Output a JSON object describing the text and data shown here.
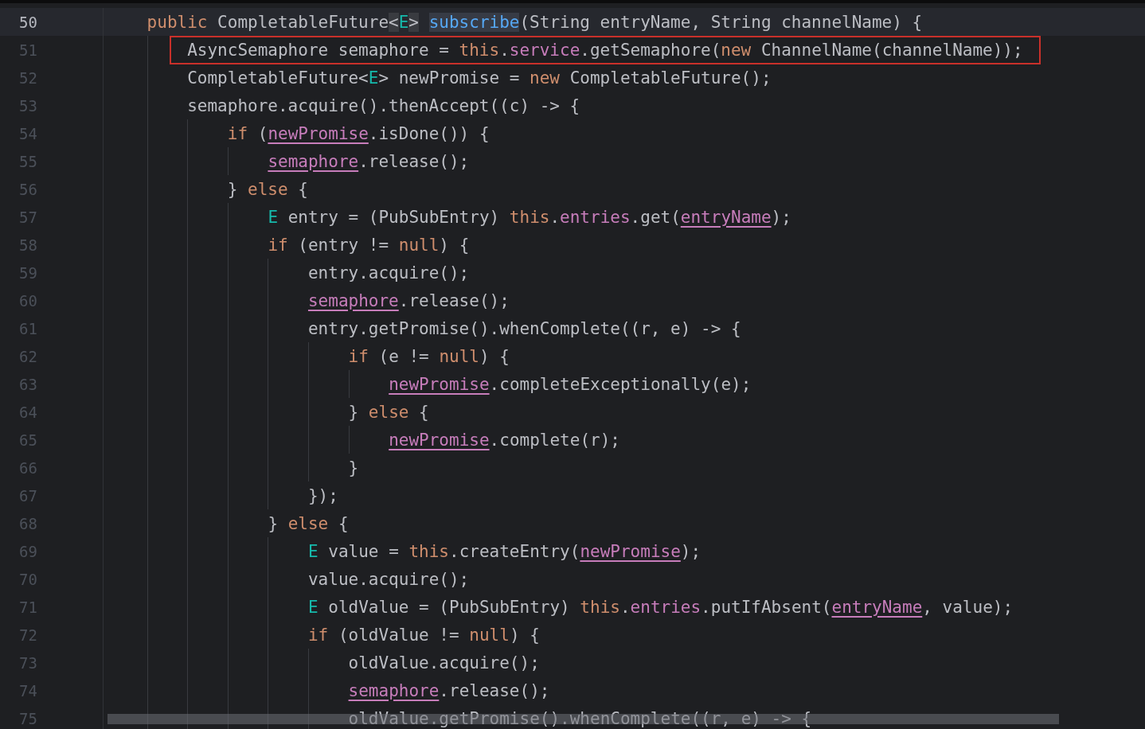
{
  "editor": {
    "lines": [
      {
        "number": "50",
        "current": true,
        "boxed": false,
        "tokens": [
          {
            "kind": "keyword",
            "text": "    public"
          },
          {
            "kind": "plain",
            "text": " CompletableFuture"
          },
          {
            "kind": "bracket_match",
            "text": "<"
          },
          {
            "kind": "type_param",
            "text": "E"
          },
          {
            "kind": "bracket_match",
            "text": ">"
          },
          {
            "kind": "symbol_highlight",
            "text": " subscribe"
          },
          {
            "kind": "plain",
            "text": "(String entryName, String channelName) {"
          }
        ]
      },
      {
        "number": "51",
        "current": false,
        "boxed": true,
        "tokens": [
          {
            "kind": "plain",
            "text": "        AsyncSemaphore semaphore = "
          },
          {
            "kind": "keyword",
            "text": "this"
          },
          {
            "kind": "plain",
            "text": "."
          },
          {
            "kind": "field",
            "text": "service"
          },
          {
            "kind": "plain",
            "text": ".getSemaphore("
          },
          {
            "kind": "keyword",
            "text": "new"
          },
          {
            "kind": "plain",
            "text": " ChannelName(channelName));"
          }
        ]
      },
      {
        "number": "52",
        "current": false,
        "boxed": false,
        "tokens": [
          {
            "kind": "plain",
            "text": "        CompletableFuture<"
          },
          {
            "kind": "type_param",
            "text": "E"
          },
          {
            "kind": "plain",
            "text": "> newPromise = "
          },
          {
            "kind": "keyword",
            "text": "new"
          },
          {
            "kind": "plain",
            "text": " CompletableFuture();"
          }
        ]
      },
      {
        "number": "53",
        "current": false,
        "boxed": false,
        "tokens": [
          {
            "kind": "plain",
            "text": "        semaphore.acquire().thenAccept((c) -> {"
          }
        ]
      },
      {
        "number": "54",
        "current": false,
        "boxed": false,
        "tokens": [
          {
            "kind": "keyword",
            "text": "            if"
          },
          {
            "kind": "plain",
            "text": " ("
          },
          {
            "kind": "captured",
            "text": "newPromise"
          },
          {
            "kind": "plain",
            "text": ".isDone()) {"
          }
        ]
      },
      {
        "number": "55",
        "current": false,
        "boxed": false,
        "tokens": [
          {
            "kind": "captured",
            "text": "                semaphore"
          },
          {
            "kind": "plain",
            "text": ".release();"
          }
        ]
      },
      {
        "number": "56",
        "current": false,
        "boxed": false,
        "tokens": [
          {
            "kind": "plain",
            "text": "            } "
          },
          {
            "kind": "keyword",
            "text": "else"
          },
          {
            "kind": "plain",
            "text": " {"
          }
        ]
      },
      {
        "number": "57",
        "current": false,
        "boxed": false,
        "tokens": [
          {
            "kind": "type_param",
            "text": "                E"
          },
          {
            "kind": "plain",
            "text": " entry = (PubSubEntry) "
          },
          {
            "kind": "keyword",
            "text": "this"
          },
          {
            "kind": "plain",
            "text": "."
          },
          {
            "kind": "field",
            "text": "entries"
          },
          {
            "kind": "plain",
            "text": ".get("
          },
          {
            "kind": "captured",
            "text": "entryName"
          },
          {
            "kind": "plain",
            "text": ");"
          }
        ]
      },
      {
        "number": "58",
        "current": false,
        "boxed": false,
        "tokens": [
          {
            "kind": "keyword",
            "text": "                if"
          },
          {
            "kind": "plain",
            "text": " (entry != "
          },
          {
            "kind": "keyword",
            "text": "null"
          },
          {
            "kind": "plain",
            "text": ") {"
          }
        ]
      },
      {
        "number": "59",
        "current": false,
        "boxed": false,
        "tokens": [
          {
            "kind": "plain",
            "text": "                    entry.acquire();"
          }
        ]
      },
      {
        "number": "60",
        "current": false,
        "boxed": false,
        "tokens": [
          {
            "kind": "captured",
            "text": "                    semaphore"
          },
          {
            "kind": "plain",
            "text": ".release();"
          }
        ]
      },
      {
        "number": "61",
        "current": false,
        "boxed": false,
        "tokens": [
          {
            "kind": "plain",
            "text": "                    entry.getPromise().whenComplete((r, e) -> {"
          }
        ]
      },
      {
        "number": "62",
        "current": false,
        "boxed": false,
        "tokens": [
          {
            "kind": "keyword",
            "text": "                        if"
          },
          {
            "kind": "plain",
            "text": " (e != "
          },
          {
            "kind": "keyword",
            "text": "null"
          },
          {
            "kind": "plain",
            "text": ") {"
          }
        ]
      },
      {
        "number": "63",
        "current": false,
        "boxed": false,
        "tokens": [
          {
            "kind": "captured",
            "text": "                            newPromise"
          },
          {
            "kind": "plain",
            "text": ".completeExceptionally(e);"
          }
        ]
      },
      {
        "number": "64",
        "current": false,
        "boxed": false,
        "tokens": [
          {
            "kind": "plain",
            "text": "                        } "
          },
          {
            "kind": "keyword",
            "text": "else"
          },
          {
            "kind": "plain",
            "text": " {"
          }
        ]
      },
      {
        "number": "65",
        "current": false,
        "boxed": false,
        "tokens": [
          {
            "kind": "captured",
            "text": "                            newPromise"
          },
          {
            "kind": "plain",
            "text": ".complete(r);"
          }
        ]
      },
      {
        "number": "66",
        "current": false,
        "boxed": false,
        "tokens": [
          {
            "kind": "plain",
            "text": "                        }"
          }
        ]
      },
      {
        "number": "67",
        "current": false,
        "boxed": false,
        "tokens": [
          {
            "kind": "plain",
            "text": "                    });"
          }
        ]
      },
      {
        "number": "68",
        "current": false,
        "boxed": false,
        "tokens": [
          {
            "kind": "plain",
            "text": "                } "
          },
          {
            "kind": "keyword",
            "text": "else"
          },
          {
            "kind": "plain",
            "text": " {"
          }
        ]
      },
      {
        "number": "69",
        "current": false,
        "boxed": false,
        "tokens": [
          {
            "kind": "type_param",
            "text": "                    E"
          },
          {
            "kind": "plain",
            "text": " value = "
          },
          {
            "kind": "keyword",
            "text": "this"
          },
          {
            "kind": "plain",
            "text": ".createEntry("
          },
          {
            "kind": "captured",
            "text": "newPromise"
          },
          {
            "kind": "plain",
            "text": ");"
          }
        ]
      },
      {
        "number": "70",
        "current": false,
        "boxed": false,
        "tokens": [
          {
            "kind": "plain",
            "text": "                    value.acquire();"
          }
        ]
      },
      {
        "number": "71",
        "current": false,
        "boxed": false,
        "tokens": [
          {
            "kind": "type_param",
            "text": "                    E"
          },
          {
            "kind": "plain",
            "text": " oldValue = (PubSubEntry) "
          },
          {
            "kind": "keyword",
            "text": "this"
          },
          {
            "kind": "plain",
            "text": "."
          },
          {
            "kind": "field",
            "text": "entries"
          },
          {
            "kind": "plain",
            "text": ".putIfAbsent("
          },
          {
            "kind": "captured",
            "text": "entryName"
          },
          {
            "kind": "plain",
            "text": ", value);"
          }
        ]
      },
      {
        "number": "72",
        "current": false,
        "boxed": false,
        "tokens": [
          {
            "kind": "keyword",
            "text": "                    if"
          },
          {
            "kind": "plain",
            "text": " (oldValue != "
          },
          {
            "kind": "keyword",
            "text": "null"
          },
          {
            "kind": "plain",
            "text": ") {"
          }
        ]
      },
      {
        "number": "73",
        "current": false,
        "boxed": false,
        "tokens": [
          {
            "kind": "plain",
            "text": "                        oldValue.acquire();"
          }
        ]
      },
      {
        "number": "74",
        "current": false,
        "boxed": false,
        "tokens": [
          {
            "kind": "captured",
            "text": "                        semaphore"
          },
          {
            "kind": "plain",
            "text": ".release();"
          }
        ]
      },
      {
        "number": "75",
        "current": false,
        "boxed": false,
        "tokens": [
          {
            "kind": "plain",
            "text": "                        oldValue.getPromise().whenComplete((r, e) -> {"
          }
        ]
      }
    ]
  }
}
